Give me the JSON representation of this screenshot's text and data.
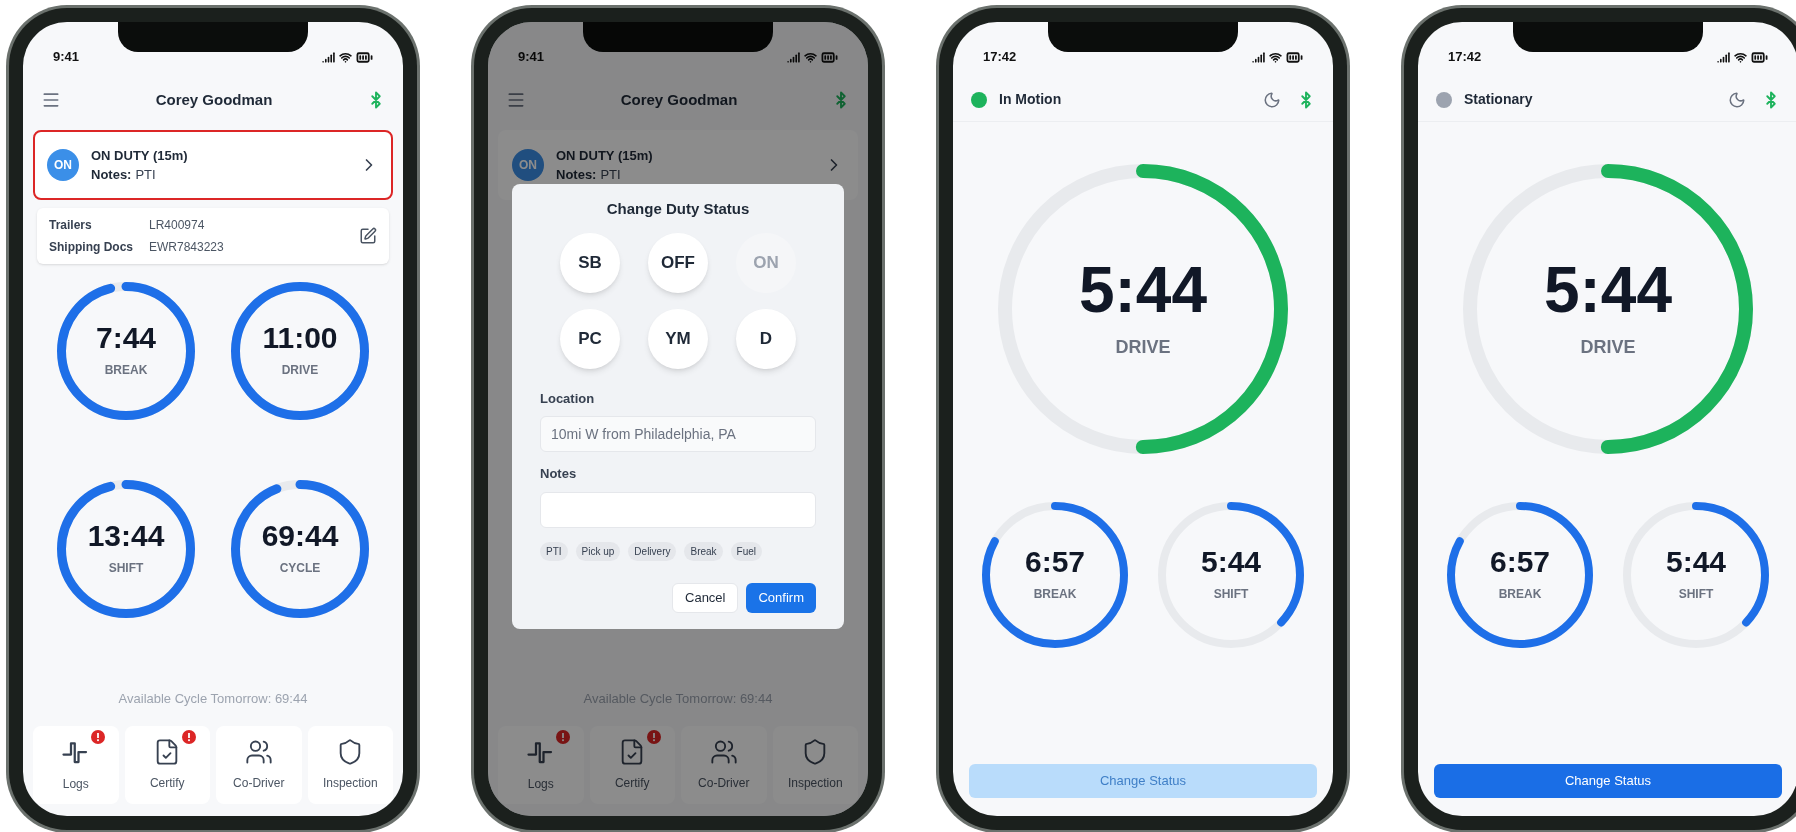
{
  "phones": [
    {
      "kind": "dashboard",
      "time": "9:41",
      "title": "Corey Goodman",
      "duty": {
        "badge": "ON",
        "status": "ON DUTY (15m)",
        "notes_label": "Notes:",
        "notes": "PTI",
        "highlighted": true
      },
      "info": [
        {
          "label": "Trailers",
          "value": "LR400974"
        },
        {
          "label": "Shipping Docs",
          "value": "EWR7843223"
        }
      ],
      "timers": [
        {
          "value": "7:44",
          "label": "BREAK",
          "level": 0.96
        },
        {
          "value": "11:00",
          "label": "DRIVE",
          "level": 1
        },
        {
          "value": "13:44",
          "label": "SHIFT",
          "level": 0.96
        },
        {
          "value": "69:44",
          "label": "CYCLE",
          "level": 0.94
        }
      ],
      "footer_note": "Available Cycle Tomorrow: 69:44",
      "nav": [
        {
          "label": "Logs",
          "alert": true
        },
        {
          "label": "Certify",
          "alert": true
        },
        {
          "label": "Co-Driver",
          "alert": false
        },
        {
          "label": "Inspection",
          "alert": false
        }
      ]
    },
    {
      "kind": "dashboard",
      "time": "9:41",
      "title": "Corey Goodman",
      "duty": {
        "badge": "ON",
        "status": "ON DUTY (15m)",
        "notes_label": "Notes:",
        "notes": "PTI",
        "highlighted": false
      },
      "footer_note": "Available Cycle Tomorrow: 69:44",
      "nav": [
        {
          "label": "Logs",
          "alert": true
        },
        {
          "label": "Certify",
          "alert": true
        },
        {
          "label": "Co-Driver",
          "alert": false
        },
        {
          "label": "Inspection",
          "alert": false
        }
      ],
      "dialog": {
        "title": "Change Duty Status",
        "statuses": [
          {
            "label": "SB",
            "disabled": false
          },
          {
            "label": "OFF",
            "disabled": false
          },
          {
            "label": "ON",
            "disabled": true
          },
          {
            "label": "PC",
            "disabled": false
          },
          {
            "label": "YM",
            "disabled": false
          },
          {
            "label": "D",
            "disabled": false
          }
        ],
        "location_label": "Location",
        "location_placeholder": "10mi W from Philadelphia, PA",
        "notes_label": "Notes",
        "chips": [
          "PTI",
          "Pick up",
          "Delivery",
          "Break",
          "Fuel"
        ],
        "cancel": "Cancel",
        "confirm": "Confirm"
      }
    },
    {
      "kind": "drive",
      "time": "17:42",
      "motion": {
        "label": "In Motion",
        "color": "#1db35c"
      },
      "main_timer": {
        "value": "5:44",
        "label": "DRIVE",
        "level": 0.5
      },
      "timers": [
        {
          "value": "6:57",
          "label": "BREAK",
          "level": 0.83
        },
        {
          "value": "5:44",
          "label": "SHIFT",
          "level": 0.37
        }
      ],
      "button": {
        "label": "Change Status",
        "disabled": true
      }
    },
    {
      "kind": "drive",
      "time": "17:42",
      "motion": {
        "label": "Stationary",
        "color": "#9ca3af"
      },
      "main_timer": {
        "value": "5:44",
        "label": "DRIVE",
        "level": 0.5
      },
      "timers": [
        {
          "value": "6:57",
          "label": "BREAK",
          "level": 0.83
        },
        {
          "value": "5:44",
          "label": "SHIFT",
          "level": 0.37
        }
      ],
      "button": {
        "label": "Change Status",
        "disabled": false
      }
    }
  ]
}
